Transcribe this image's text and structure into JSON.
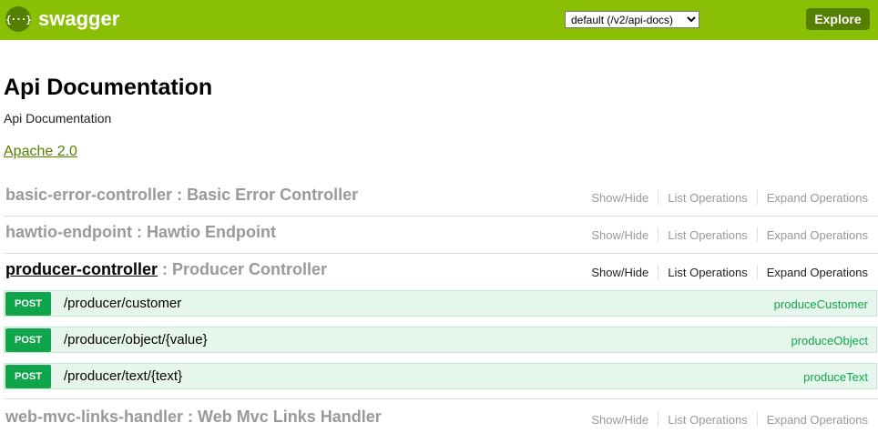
{
  "header": {
    "logo_glyph": "{···}",
    "logo_text": "swagger",
    "spec_select": {
      "selected": "default (/v2/api-docs)"
    },
    "explore_label": "Explore",
    "colors": {
      "bar": "#89bf04",
      "accent": "#547f00"
    }
  },
  "info": {
    "title": "Api Documentation",
    "description": "Api Documentation",
    "license": "Apache 2.0"
  },
  "resources": [
    {
      "name": "basic-error-controller",
      "separator": " : ",
      "description": "Basic Error Controller",
      "links": {
        "show_hide": "Show/Hide",
        "list_operations": "List Operations",
        "expand_operations": "Expand Operations"
      }
    },
    {
      "name": "hawtio-endpoint",
      "separator": " : ",
      "description": "Hawtio Endpoint",
      "links": {
        "show_hide": "Show/Hide",
        "list_operations": "List Operations",
        "expand_operations": "Expand Operations"
      }
    },
    {
      "name": "producer-controller",
      "separator": " : ",
      "description": "Producer Controller",
      "links": {
        "show_hide": "Show/Hide",
        "list_operations": "List Operations",
        "expand_operations": "Expand Operations"
      },
      "operations": [
        {
          "method": "POST",
          "path": "/producer/customer",
          "nickname": "produceCustomer"
        },
        {
          "method": "POST",
          "path": "/producer/object/{value}",
          "nickname": "produceObject"
        },
        {
          "method": "POST",
          "path": "/producer/text/{text}",
          "nickname": "produceText"
        }
      ]
    },
    {
      "name": "web-mvc-links-handler",
      "separator": " : ",
      "description": "Web Mvc Links Handler",
      "links": {
        "show_hide": "Show/Hide",
        "list_operations": "List Operations",
        "expand_operations": "Expand Operations"
      }
    }
  ],
  "colors": {
    "post_method": "#10a54a",
    "post_background": "#e7f6ec",
    "muted_text": "#999999"
  }
}
